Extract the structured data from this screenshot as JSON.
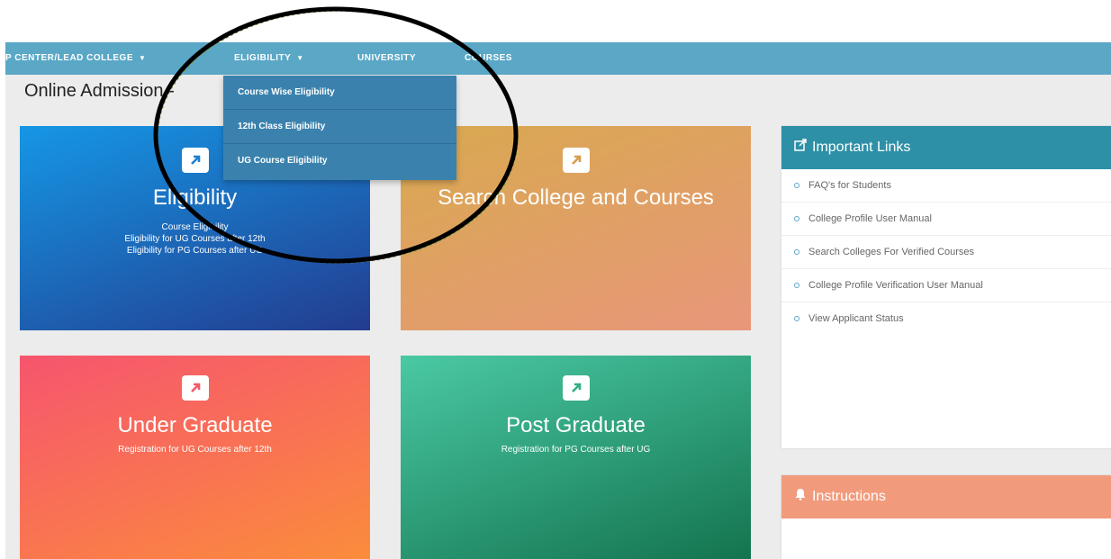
{
  "navbar": {
    "items": [
      {
        "label": "P CENTER/LEAD COLLEGE",
        "caret": "▼"
      },
      {
        "label": "ELIGIBILITY",
        "caret": "▼"
      },
      {
        "label": "UNIVERSITY"
      },
      {
        "label": "COURSES"
      }
    ]
  },
  "page_title": "Online Admission -",
  "dropdown": {
    "items": [
      "Course Wise Eligibility",
      "12th Class Eligibility",
      "UG Course Eligibility"
    ]
  },
  "tiles": [
    {
      "title": "Eligibility",
      "lines": [
        "Course Eligibility",
        "Eligibility for UG Courses after 12th",
        "Eligibility for PG Courses after UG"
      ],
      "colors": [
        "#1597e5",
        "#233c8f"
      ]
    },
    {
      "title": "Search College and Courses",
      "lines": [],
      "colors": [
        "#d8a94f",
        "#e8977a"
      ]
    },
    {
      "title": "Under Graduate",
      "lines": [
        "Registration for UG Courses after 12th"
      ],
      "colors": [
        "#f6556e",
        "#fb8c3c"
      ]
    },
    {
      "title": "Post Graduate",
      "lines": [
        "Registration for PG Courses after UG"
      ],
      "colors": [
        "#4ac9a4",
        "#13744f"
      ]
    }
  ],
  "important_links": {
    "icon": "external-link-icon",
    "title": "Important Links",
    "color": "#2d90a7",
    "items": [
      "FAQ's for Students",
      "College Profile User Manual",
      "Search Colleges For Verified Courses",
      "College Profile Verification User Manual",
      "View Applicant Status"
    ]
  },
  "instructions": {
    "icon": "bell-icon",
    "title": "Instructions",
    "color": "#f29b7c"
  }
}
